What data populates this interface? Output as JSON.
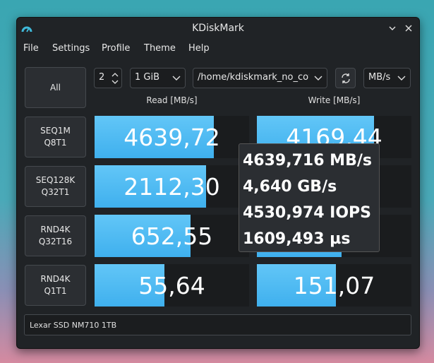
{
  "window": {
    "title": "KDiskMark"
  },
  "menu": [
    "File",
    "Settings",
    "Profile",
    "Theme",
    "Help"
  ],
  "controls": {
    "all_label": "All",
    "runs": "2",
    "size": "1 GiB",
    "path": "/home/kdiskmark_no_cow",
    "units": "MB/s"
  },
  "columns": {
    "read": "Read [MB/s]",
    "write": "Write [MB/s]"
  },
  "rows": [
    {
      "line1": "SEQ1M",
      "line2": "Q8T1",
      "read": "4639,72",
      "write": "4169,44",
      "read_fill": 0.77,
      "write_fill": 0.76
    },
    {
      "line1": "SEQ128K",
      "line2": "Q32T1",
      "read": "2112,30",
      "write": "",
      "read_fill": 0.72,
      "write_fill": 0.58
    },
    {
      "line1": "RND4K",
      "line2": "Q32T16",
      "read": "652,55",
      "write": "",
      "read_fill": 0.62,
      "write_fill": 0.55
    },
    {
      "line1": "RND4K",
      "line2": "Q1T1",
      "read": "55,64",
      "write": "151,07",
      "read_fill": 0.45,
      "write_fill": 0.51
    }
  ],
  "tooltip": [
    "4639,716 MB/s",
    "4,640 GB/s",
    "4530,974 IOPS",
    "1609,493 µs"
  ],
  "device": "Lexar SSD NM710 1TB"
}
